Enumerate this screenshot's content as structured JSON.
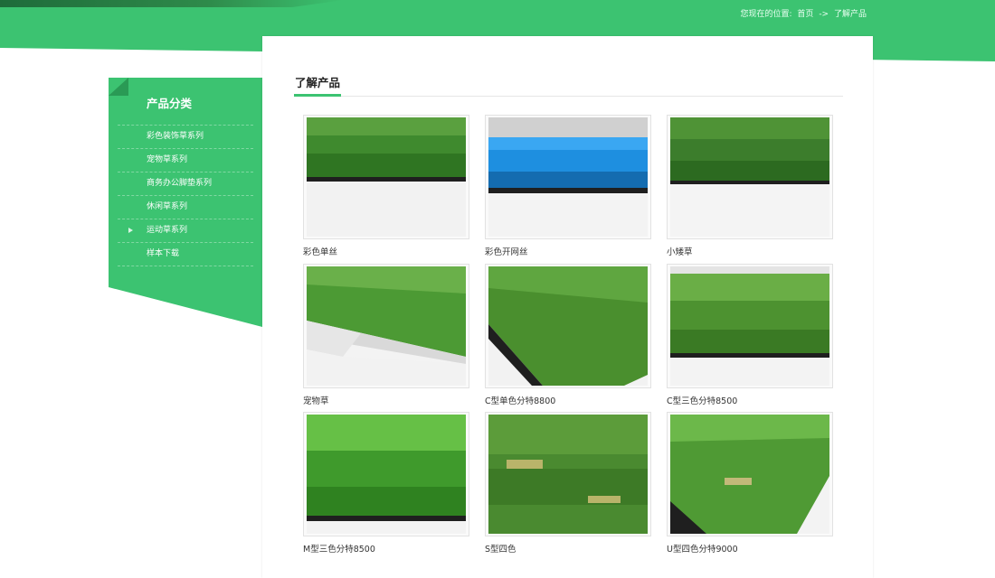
{
  "breadcrumb": {
    "prefix": "您现在的位置:",
    "home": "首页",
    "separator": "->",
    "current": "了解产品"
  },
  "sidebar": {
    "title": "产品分类",
    "items": [
      {
        "label": "彩色装饰草系列"
      },
      {
        "label": "宠物草系列"
      },
      {
        "label": "商务办公脚垫系列"
      },
      {
        "label": "休闲草系列"
      },
      {
        "label": "运动草系列"
      },
      {
        "label": "样本下载"
      }
    ]
  },
  "main": {
    "title": "了解产品",
    "products": [
      {
        "name": "彩色单丝"
      },
      {
        "name": "彩色开网丝"
      },
      {
        "name": "小矮草"
      },
      {
        "name": "宠物草"
      },
      {
        "name": "C型单色分特8800"
      },
      {
        "name": "C型三色分特8500"
      },
      {
        "name": "M型三色分特8500"
      },
      {
        "name": "S型四色"
      },
      {
        "name": "U型四色分特9000"
      }
    ]
  },
  "colors": {
    "brand_green": "#3cc371",
    "turf_blue": "#1e8fe0"
  }
}
